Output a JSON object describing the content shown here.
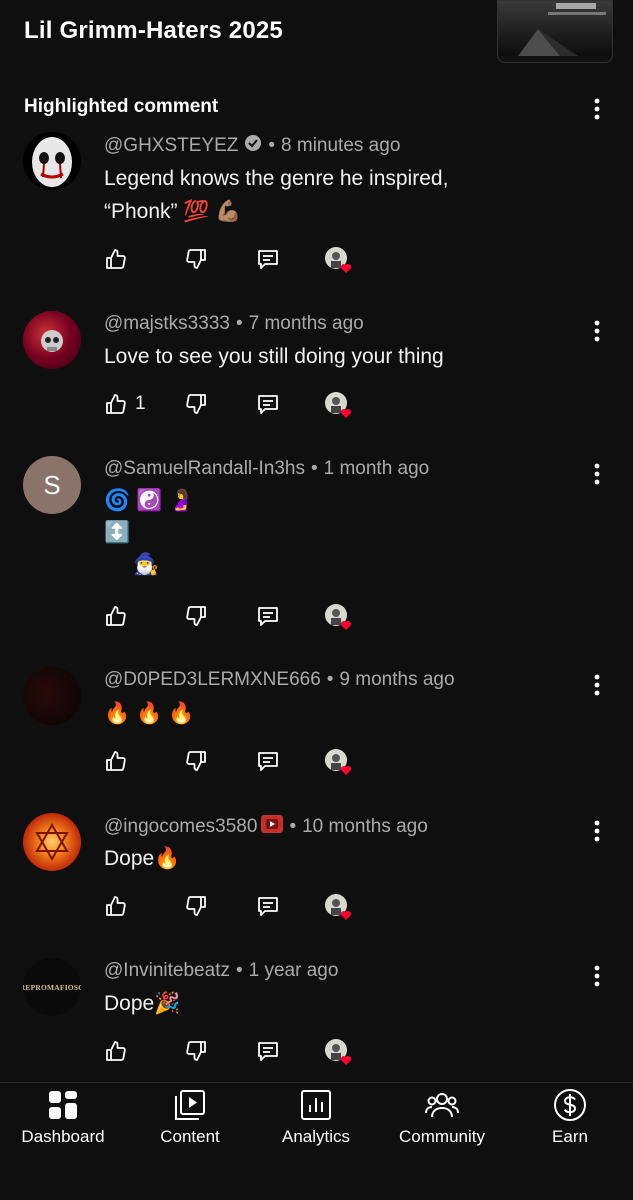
{
  "header": {
    "title": "Lil Grimm-Haters 2025"
  },
  "section": {
    "title": "Highlighted comment"
  },
  "comments": [
    {
      "handle": "@GHXSTEYEZ",
      "badge": "verified-icon",
      "time": "8 minutes ago",
      "text": "Legend knows the genre he inspired,\n“Phonk” 💯 💪🏽",
      "likes": "",
      "avatar_letter": ""
    },
    {
      "handle": "@majstks3333",
      "badge": "",
      "time": "7 months ago",
      "text": "Love to see you still doing your thing",
      "likes": "1",
      "avatar_letter": ""
    },
    {
      "handle": "@SamuelRandall-In3hs",
      "badge": "",
      "time": "1 month ago",
      "text": "🌀 ☯️ 🤰\n↕️\n     🧙‍♂️",
      "likes": "",
      "avatar_letter": "S"
    },
    {
      "handle": "@D0PED3LERMXNE666",
      "badge": "",
      "time": "9 months ago",
      "text": "🔥 🔥 🔥",
      "likes": "",
      "avatar_letter": ""
    },
    {
      "handle": "@ingocomes3580",
      "badge": "member-icon",
      "time": "10 months ago",
      "text": "Dope🔥",
      "likes": "",
      "avatar_letter": ""
    },
    {
      "handle": "@Invinitebeatz",
      "badge": "",
      "time": "1 year ago",
      "text": "Dope🎉",
      "likes": "",
      "avatar_letter": "",
      "avatar_text": "REPROMAFIOSO"
    }
  ],
  "bottom_nav": [
    {
      "label": "Dashboard",
      "icon": "dashboard-icon"
    },
    {
      "label": "Content",
      "icon": "content-icon"
    },
    {
      "label": "Analytics",
      "icon": "analytics-icon"
    },
    {
      "label": "Community",
      "icon": "community-icon"
    },
    {
      "label": "Earn",
      "icon": "earn-icon"
    }
  ],
  "colors": {
    "background": "#0f0f0f",
    "meta": "#aaaaaa",
    "text": "#f1f1f1",
    "heart": "#ff0033"
  }
}
